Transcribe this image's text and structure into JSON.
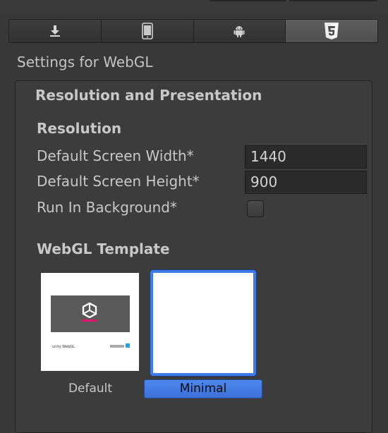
{
  "platform_tabs": [
    {
      "icon": "download-icon",
      "active": false
    },
    {
      "icon": "mobile-device-icon",
      "active": false
    },
    {
      "icon": "android-icon",
      "active": false
    },
    {
      "icon": "html5-icon",
      "active": true
    }
  ],
  "settings_title": "Settings for WebGL",
  "section": {
    "title": "Resolution and Presentation",
    "resolution": {
      "header": "Resolution",
      "width_label": "Default Screen Width*",
      "width_value": "1440",
      "height_label": "Default Screen Height*",
      "height_value": "900",
      "background_label": "Run In Background*",
      "background_checked": false
    },
    "webgl_template": {
      "header": "WebGL Template",
      "templates": [
        {
          "label": "Default",
          "selected": false,
          "thumb_caption": "unity WebGL"
        },
        {
          "label": "Minimal",
          "selected": true
        }
      ]
    }
  },
  "colors": {
    "background": "#383838",
    "selection_accent": "#3d7ce8",
    "unity_pink": "#e0156b"
  }
}
